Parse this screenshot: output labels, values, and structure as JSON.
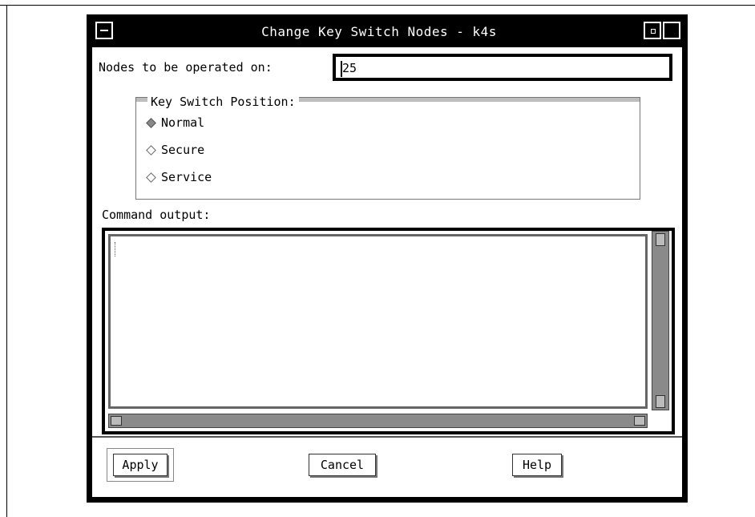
{
  "window": {
    "title": "Change Key Switch Nodes - k4s"
  },
  "nodes": {
    "label": "Nodes to be operated on:",
    "value": "25"
  },
  "key_switch": {
    "legend": "Key Switch Position:",
    "options": [
      {
        "label": "Normal",
        "selected": true
      },
      {
        "label": "Secure",
        "selected": false
      },
      {
        "label": "Service",
        "selected": false
      }
    ]
  },
  "output": {
    "label": "Command output:",
    "text": ""
  },
  "buttons": {
    "apply": "Apply",
    "cancel": "Cancel",
    "help": "Help"
  }
}
